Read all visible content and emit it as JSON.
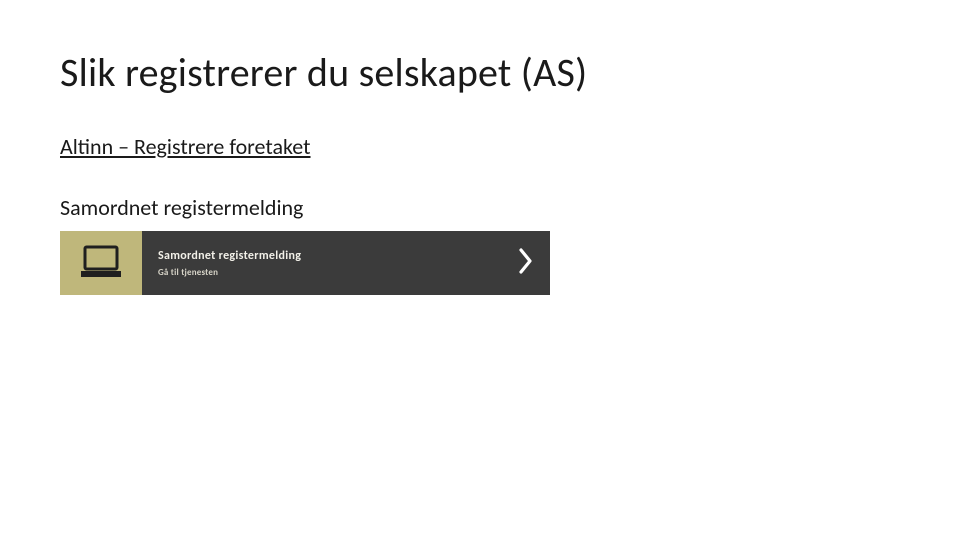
{
  "title": "Slik registrerer du selskapet (AS)",
  "link_text": "Altinn – Registrere foretaket",
  "subheading": "Samordnet registermelding",
  "card": {
    "title": "Samordnet registermelding",
    "subtitle": "Gå til tjenesten"
  }
}
